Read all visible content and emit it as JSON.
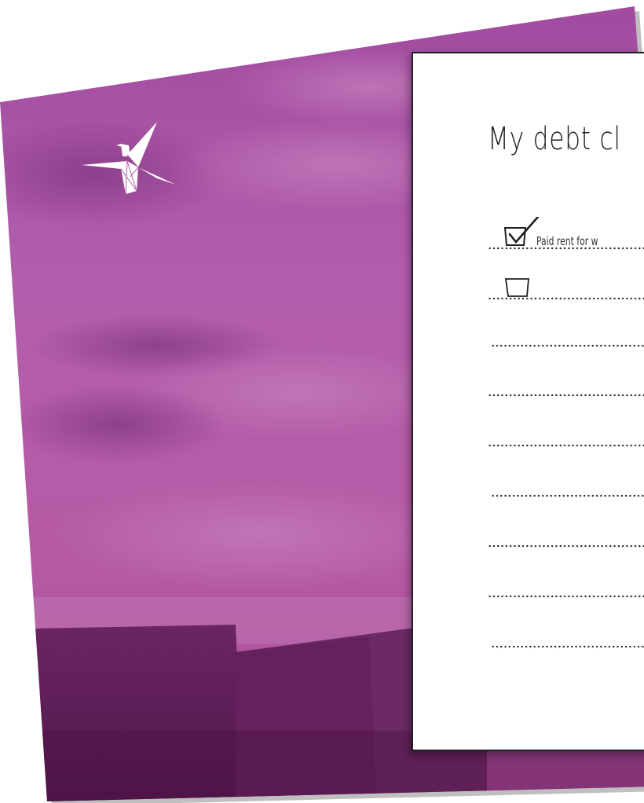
{
  "checklist": {
    "title": "My debt cl",
    "items": [
      {
        "text": "Paid rent for w",
        "checked": true
      },
      {
        "text": "",
        "checked": false
      },
      {
        "text": ""
      },
      {
        "text": ""
      },
      {
        "text": ""
      },
      {
        "text": ""
      },
      {
        "text": ""
      },
      {
        "text": ""
      },
      {
        "text": ""
      }
    ]
  },
  "colors": {
    "sky": "#b25aa8",
    "sky_dark": "#8a3a86",
    "land": "#5e1f57",
    "card_border": "#1f1f1f",
    "ink": "#1e1e1e"
  },
  "icons": [
    "paper-crane-icon",
    "checkbox-checked-icon",
    "checkbox-empty-icon"
  ]
}
